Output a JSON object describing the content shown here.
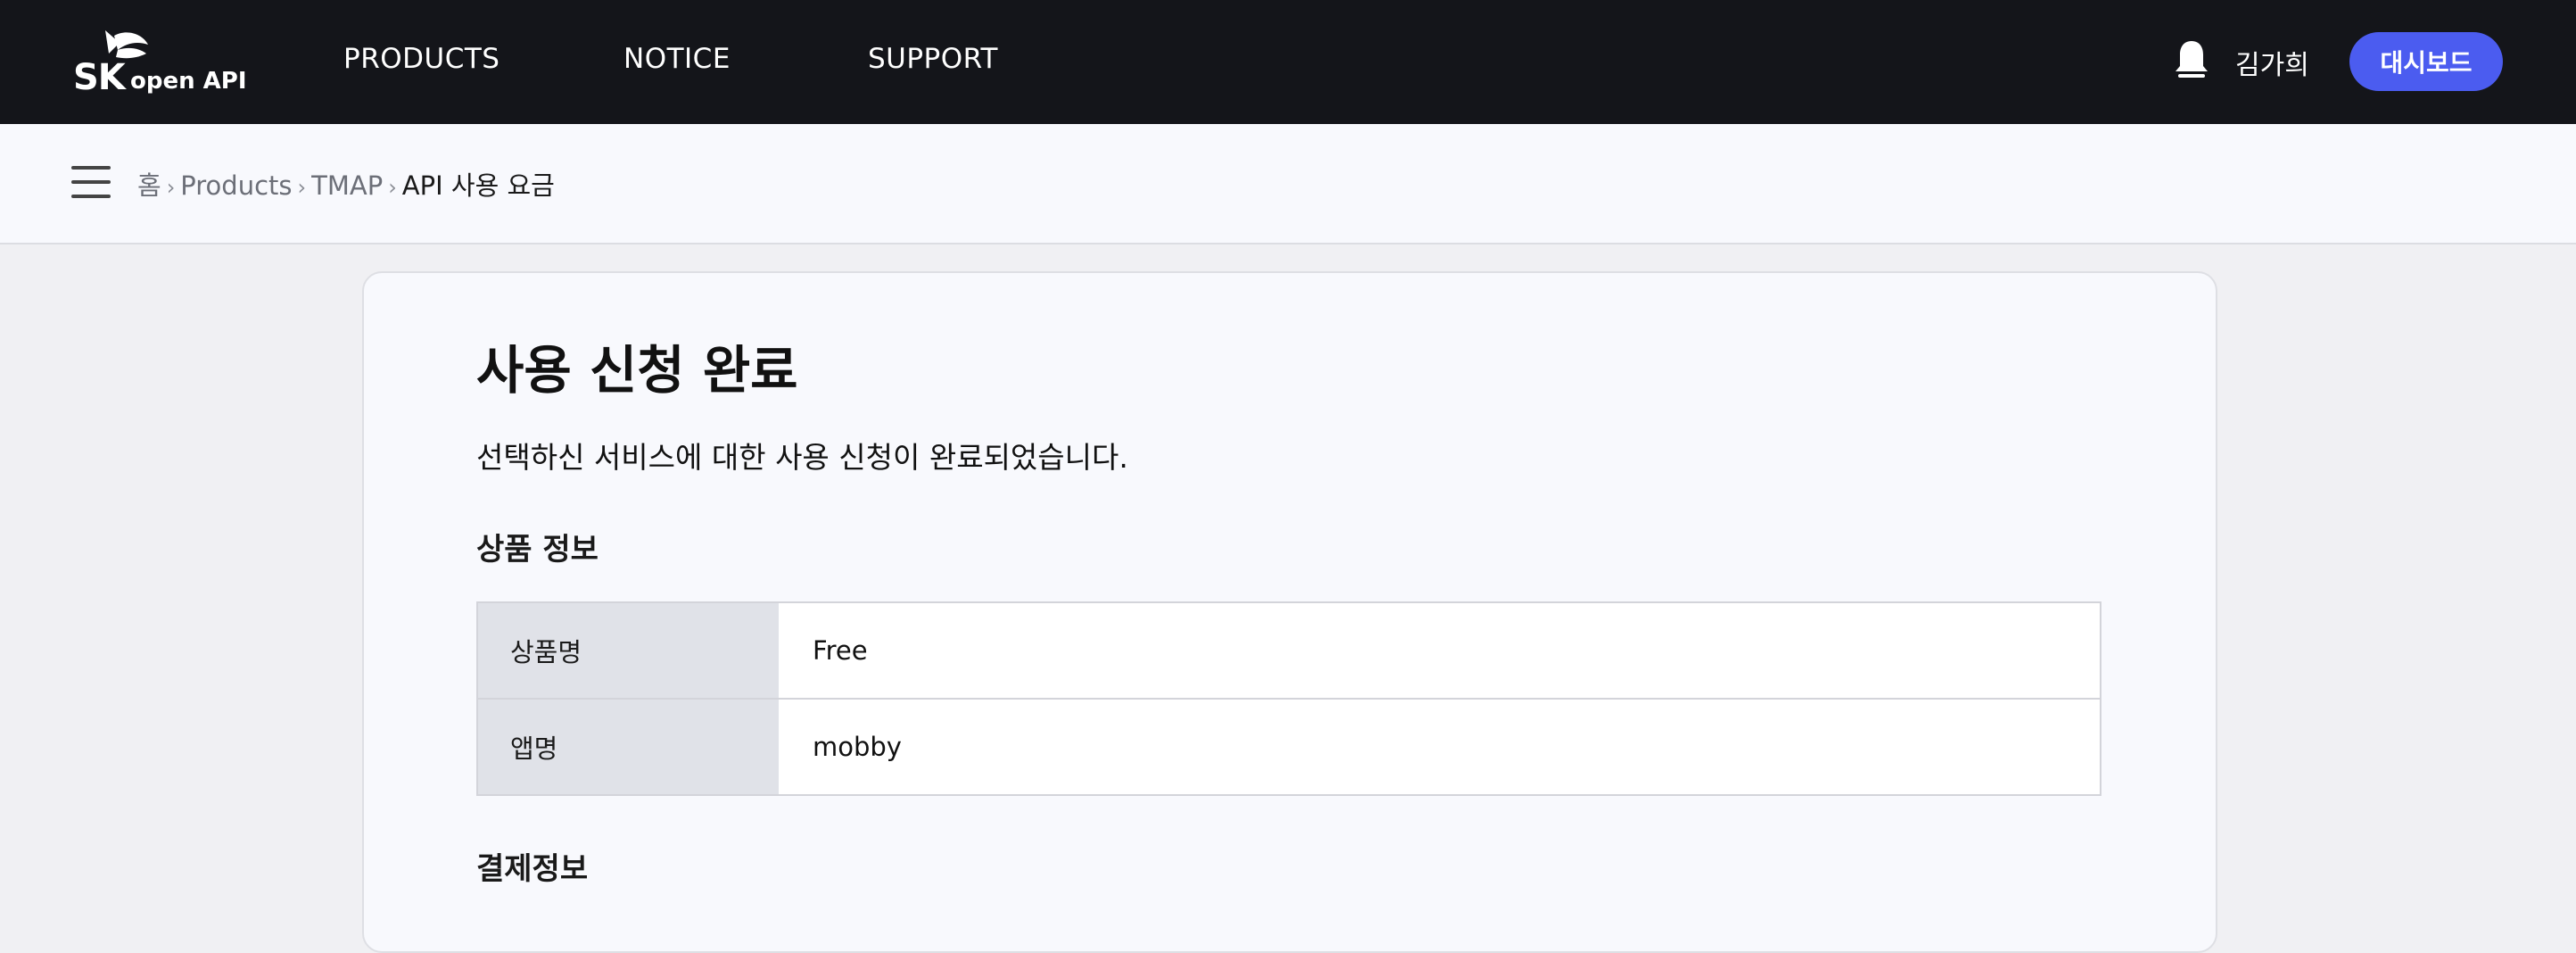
{
  "header": {
    "logo": {
      "brand": "SK",
      "text": "open API"
    },
    "nav": [
      "PRODUCTS",
      "NOTICE",
      "SUPPORT"
    ],
    "user_name": "김가희",
    "dashboard_label": "대시보드"
  },
  "breadcrumb": {
    "items": [
      "홈",
      "Products",
      "TMAP",
      "API 사용 요금"
    ],
    "separator": "›"
  },
  "main": {
    "title": "사용 신청 완료",
    "description": "선택하신 서비스에 대한 사용 신청이 완료되었습니다.",
    "product_section": {
      "heading": "상품 정보",
      "rows": [
        {
          "label": "상품명",
          "value": "Free"
        },
        {
          "label": "앱명",
          "value": "mobby"
        }
      ]
    },
    "payment_section": {
      "heading": "결제정보"
    }
  },
  "colors": {
    "topbar": "#14151a",
    "accent": "#4b5cf0",
    "logo_red": "#e8112d",
    "logo_orange": "#f47725"
  },
  "icons": [
    "sk-logo-icon",
    "bell-icon",
    "hamburger-menu-icon"
  ]
}
